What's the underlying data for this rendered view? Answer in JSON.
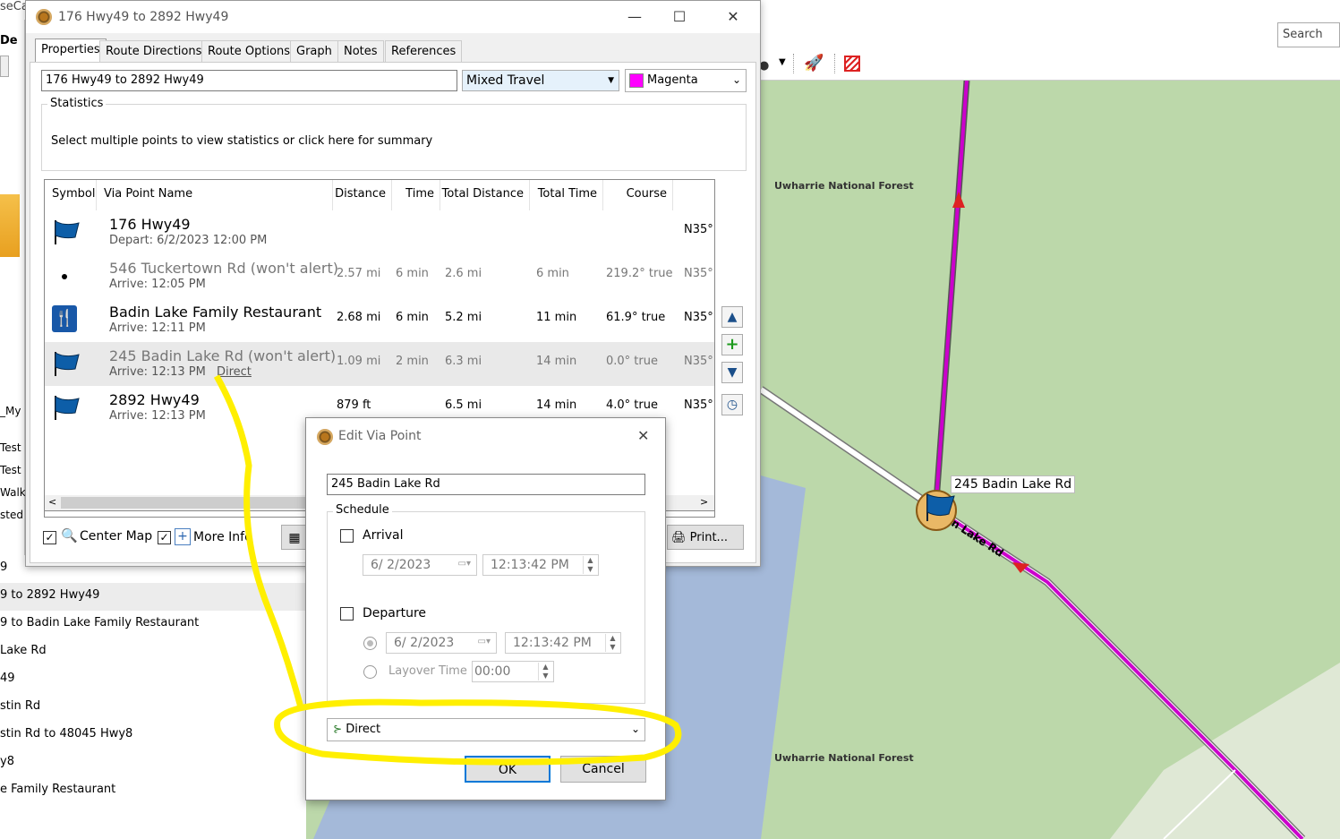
{
  "app": {
    "title_fragment": "seCa",
    "menu_fragment": "De",
    "search_label": "Search"
  },
  "window": {
    "title": "176 Hwy49 to 2892 Hwy49",
    "minimize": "—",
    "maximize": "☐",
    "close": "✕"
  },
  "tabs": [
    "Properties",
    "Route Directions",
    "Route Options",
    "Graph",
    "Notes",
    "References"
  ],
  "properties": {
    "route_name": "176 Hwy49 to 2892 Hwy49",
    "travel_mode": "Mixed Travel",
    "color_name": "Magenta",
    "color_hex": "#ff00ff",
    "stats_label": "Statistics",
    "stats_text": "Select multiple points to view statistics or click here for summary"
  },
  "grid": {
    "headers": [
      "Symbol",
      "Via Point Name",
      "Distance",
      "Time",
      "Total Distance",
      "Total Time",
      "Course"
    ],
    "rows": [
      {
        "icon": "flag",
        "name": "176 Hwy49",
        "sub": "Depart: 6/2/2023 12:00 PM",
        "distance": "",
        "time": "",
        "total_distance": "",
        "total_time": "",
        "course": "",
        "coord": "N35°",
        "muted": false
      },
      {
        "icon": "dot",
        "name": "546 Tuckertown Rd (won't alert)",
        "sub": "Arrive: 12:05 PM",
        "distance": "2.57 mi",
        "time": "6 min",
        "total_distance": "2.6 mi",
        "total_time": "6 min",
        "course": "219.2° true",
        "coord": "N35°",
        "muted": true
      },
      {
        "icon": "restaurant",
        "name": "Badin Lake Family Restaurant",
        "sub": "Arrive: 12:11 PM",
        "distance": "2.68 mi",
        "time": "6 min",
        "total_distance": "5.2 mi",
        "total_time": "11 min",
        "course": "61.9° true",
        "coord": "N35°",
        "muted": false
      },
      {
        "icon": "flag",
        "name": "245 Badin Lake Rd (won't alert)",
        "sub": "Arrive: 12:13 PM",
        "sub_link": "Direct",
        "distance": "1.09 mi",
        "time": "2 min",
        "total_distance": "6.3 mi",
        "total_time": "14 min",
        "course": "0.0° true",
        "coord": "N35°",
        "muted": true
      },
      {
        "icon": "flag",
        "name": "2892 Hwy49",
        "sub": "Arrive: 12:13 PM",
        "distance": "879 ft",
        "time": "",
        "total_distance": "6.5 mi",
        "total_time": "14 min",
        "course": "4.0° true",
        "coord": "N35°",
        "muted": false
      }
    ]
  },
  "bottom": {
    "center_map": "Center Map",
    "more_info": "More Info",
    "print": "Print..."
  },
  "list": {
    "items": [
      "9",
      "9 to 2892 Hwy49",
      "9 to Badin Lake Family Restaurant",
      "Lake Rd",
      "49",
      "stin Rd",
      "stin Rd to 48045 Hwy8",
      "y8",
      "e Family Restaurant"
    ],
    "left_fragments": [
      "_My",
      "Test",
      "Test",
      "Walk",
      "sted"
    ]
  },
  "dialog": {
    "title": "Edit Via Point",
    "close": "✕",
    "name_value": "245 Badin Lake Rd",
    "schedule_label": "Schedule",
    "arrival_label": "Arrival",
    "arrival_date": "6/  2/2023",
    "arrival_time": "12:13:42 PM",
    "departure_label": "Departure",
    "departure_date": "6/  2/2023",
    "departure_time": "12:13:42 PM",
    "layover_label": "Layover Time",
    "layover_value": "00:00",
    "routing_value": "Direct",
    "ok": "OK",
    "cancel": "Cancel"
  },
  "map": {
    "forest_label_1": "Uwharrie National Forest",
    "forest_label_2": "Uwharrie National Forest",
    "pin_label": "245 Badin Lake Rd",
    "road_label": "n Lake Rd",
    "route_color": "#cc00cc",
    "forest_color": "#bcd8aa",
    "water_color": "#a4b9d9",
    "annotation_color": "#ffef00"
  }
}
